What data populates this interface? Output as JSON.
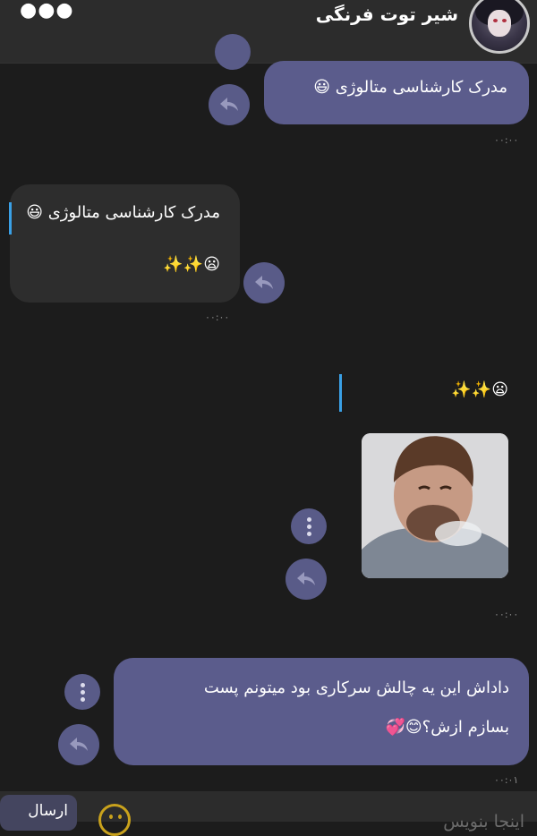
{
  "header": {
    "title": "شیر توت فرنگی",
    "menu_glyph": "●●●"
  },
  "messages": [
    {
      "id": "m1",
      "text": "مدرک کارشناسی متالوژی 😃",
      "time": "۰۰:۰۰"
    },
    {
      "id": "m2",
      "quote": "مدرک کارشناسی متالوژی 😃",
      "text": "😦✨✨",
      "time": "۰۰:۰۰"
    },
    {
      "id": "m3",
      "quote": "😦✨✨",
      "time": "۰۰:۰۰"
    },
    {
      "id": "m4",
      "text_line1": "داداش این یه چالش سرکاری بود میتونم پست",
      "text_line2": "بسازم ازش؟😊💞",
      "time": "۰۰:۰۱"
    }
  ],
  "composer": {
    "placeholder": "اینجا بنویس",
    "send_label": "ارسال"
  },
  "icons": {
    "reply": "reply-icon",
    "menu": "vertical-dots-icon",
    "emoji": "smiley-icon"
  },
  "colors": {
    "outgoing_bubble": "#5b5c8c",
    "incoming_bubble": "#2d2d2d",
    "accent_cursor": "#3aa0e6"
  }
}
